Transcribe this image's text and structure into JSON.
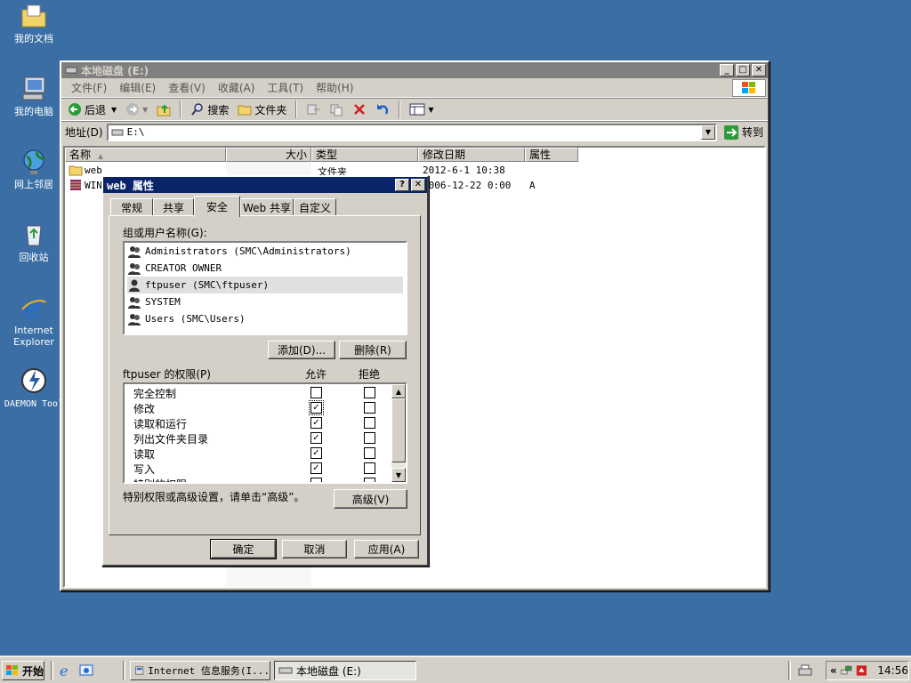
{
  "desktop": {
    "icons": [
      {
        "label": "我的文档",
        "icon": "my-documents-icon"
      },
      {
        "label": "我的电脑",
        "icon": "my-computer-icon"
      },
      {
        "label": "网上邻居",
        "icon": "network-places-icon"
      },
      {
        "label": "回收站",
        "icon": "recycle-bin-icon"
      },
      {
        "label": "Internet Explorer",
        "icon": "internet-explorer-icon"
      },
      {
        "label": "DAEMON Tool",
        "icon": "daemon-tools-icon"
      }
    ]
  },
  "explorer": {
    "title": "本地磁盘  (E:)",
    "menu": [
      "文件(F)",
      "编辑(E)",
      "查看(V)",
      "收藏(A)",
      "工具(T)",
      "帮助(H)"
    ],
    "toolbar": {
      "back": "后退",
      "search": "搜索",
      "folders": "文件夹"
    },
    "address": {
      "label": "地址(D)",
      "value": "E:\\",
      "go": "转到"
    },
    "columns": [
      "名称",
      "大小",
      "类型",
      "修改日期",
      "属性"
    ],
    "files": [
      {
        "name": "web",
        "size": "",
        "type": "文件夹",
        "modified": "2012-6-1 10:38",
        "attr": ""
      },
      {
        "name": "WINC",
        "size": "",
        "type": "",
        "modified": "2006-12-22 0:00",
        "attr": "A"
      }
    ]
  },
  "dialog": {
    "title": "web 属性",
    "tabs": [
      "常规",
      "共享",
      "安全",
      "Web 共享",
      "自定义"
    ],
    "selected_tab": "安全",
    "group_label": "组或用户名称(G):",
    "users": [
      "Administrators (SMC\\Administrators)",
      "CREATOR OWNER",
      "ftpuser (SMC\\ftpuser)",
      "SYSTEM",
      "Users (SMC\\Users)"
    ],
    "selected_user": "ftpuser (SMC\\ftpuser)",
    "add_button": "添加(D)...",
    "remove_button": "删除(R)",
    "perm_label": "ftpuser 的权限(P)",
    "allow_label": "允许",
    "deny_label": "拒绝",
    "permissions": [
      {
        "name": "完全控制",
        "allow": false,
        "deny": false
      },
      {
        "name": "修改",
        "allow": true,
        "deny": false
      },
      {
        "name": "读取和运行",
        "allow": true,
        "deny": false
      },
      {
        "name": "列出文件夹目录",
        "allow": true,
        "deny": false
      },
      {
        "name": "读取",
        "allow": true,
        "deny": false
      },
      {
        "name": "写入",
        "allow": true,
        "deny": false
      },
      {
        "name": "特别的权限",
        "allow": false,
        "deny": false
      }
    ],
    "advanced_hint": "特别权限或高级设置，请单击“高级”。",
    "advanced_button": "高级(V)",
    "ok": "确定",
    "cancel": "取消",
    "apply": "应用(A)"
  },
  "taskbar": {
    "start": "开始",
    "tasks": [
      "Internet 信息服务(I...",
      "本地磁盘  (E:)"
    ],
    "clock": "14:56"
  },
  "colors": {
    "desktop": "#3a6ea5",
    "active_title": "#0a246a",
    "inactive_title": "#808080",
    "face": "#d4d0c8"
  }
}
